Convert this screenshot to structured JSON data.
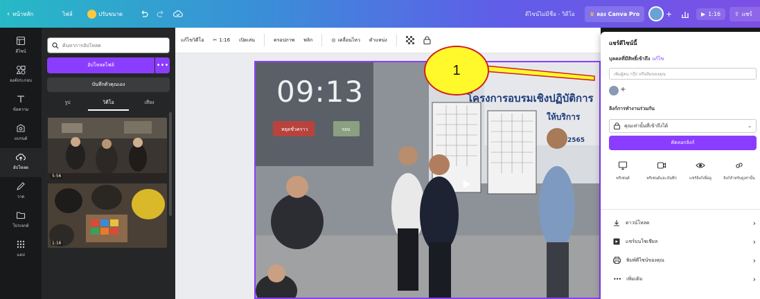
{
  "topbar": {
    "home": "หน้าหลัก",
    "file": "ไฟล์",
    "resize": "ปรับขนาด",
    "doc_title": "ดีไซน์ไม่มีชื่อ - วิดีโอ",
    "try_pro": "ลอง Canva Pro",
    "play_time": "1:16",
    "share": "แชร์"
  },
  "rail": {
    "items": [
      {
        "label": "ดีไซน์",
        "icon": "template-icon"
      },
      {
        "label": "องค์ประกอบ",
        "icon": "elements-icon"
      },
      {
        "label": "ข้อความ",
        "icon": "text-icon"
      },
      {
        "label": "แบรนด์",
        "icon": "brand-icon"
      },
      {
        "label": "อัปโหลด",
        "icon": "upload-icon"
      },
      {
        "label": "วาด",
        "icon": "draw-icon"
      },
      {
        "label": "โปรเจกต์",
        "icon": "folder-icon"
      },
      {
        "label": "แอป",
        "icon": "apps-icon"
      }
    ]
  },
  "panel": {
    "search_placeholder": "ค้นหาการอัปโหลด",
    "upload_button": "อัปโหลดไฟล์",
    "more": "•••",
    "record_button": "บันทึกตัวคุณเอง",
    "tabs": [
      "รูป",
      "วิดีโอ",
      "เสียง"
    ],
    "videos": [
      {
        "duration": "5:56"
      },
      {
        "duration": "1:16"
      }
    ]
  },
  "toolbar": {
    "items": [
      "แก้ไขวิดีโอ",
      "1:16",
      "เปิดเล่น",
      "ครอปภาพ",
      "พลิก",
      "เคลื่อนไหว",
      "ตำแหน่ง"
    ]
  },
  "canvas": {
    "clock": "09:13",
    "banner": "โครงการอบรมเชิงปฏิบัติการ",
    "banner2": "ให้บริการ",
    "year": "2565",
    "btn_red": "หยุดชั่วคราว",
    "btn_grey": "รอบ"
  },
  "share_panel": {
    "title": "แชร์ดีไซน์นี้",
    "people_label": "บุคคลที่มีสิทธิ์เข้าถึง",
    "edit": "แก้ไข",
    "input_placeholder": "เพิ่มผู้คน กรุ๊ป หรือทีมของคุณ",
    "link_label": "ลิงก์การทำงานร่วมกัน",
    "link_option": "คุณเท่านั้นที่เข้าถึงได้",
    "copy_link": "คัดลอกลิงก์",
    "options": [
      {
        "label": "พรีเซนต์",
        "icon": "present-icon"
      },
      {
        "label": "พรีเซนต์และบันทึก",
        "icon": "record-icon"
      },
      {
        "label": "แชร์ลิงก์เพื่อดู",
        "icon": "view-icon"
      },
      {
        "label": "ลิงก์สำหรับดูเท่านั้น",
        "icon": "link-icon"
      }
    ],
    "rows": [
      {
        "label": "ดาวน์โหลด",
        "icon": "download-icon"
      },
      {
        "label": "แชร์บนโซเชียล",
        "icon": "social-icon"
      },
      {
        "label": "พิมพ์ดีไซน์ของคุณ",
        "icon": "print-icon"
      },
      {
        "label": "เพิ่มเติม",
        "icon": "more-icon"
      }
    ]
  },
  "annotation": {
    "number": "1",
    "fill": "#fff82a",
    "stroke": "#d11f1f"
  },
  "colors": {
    "accent": "#8b3dff",
    "pro_crown": "#ffc83d"
  }
}
